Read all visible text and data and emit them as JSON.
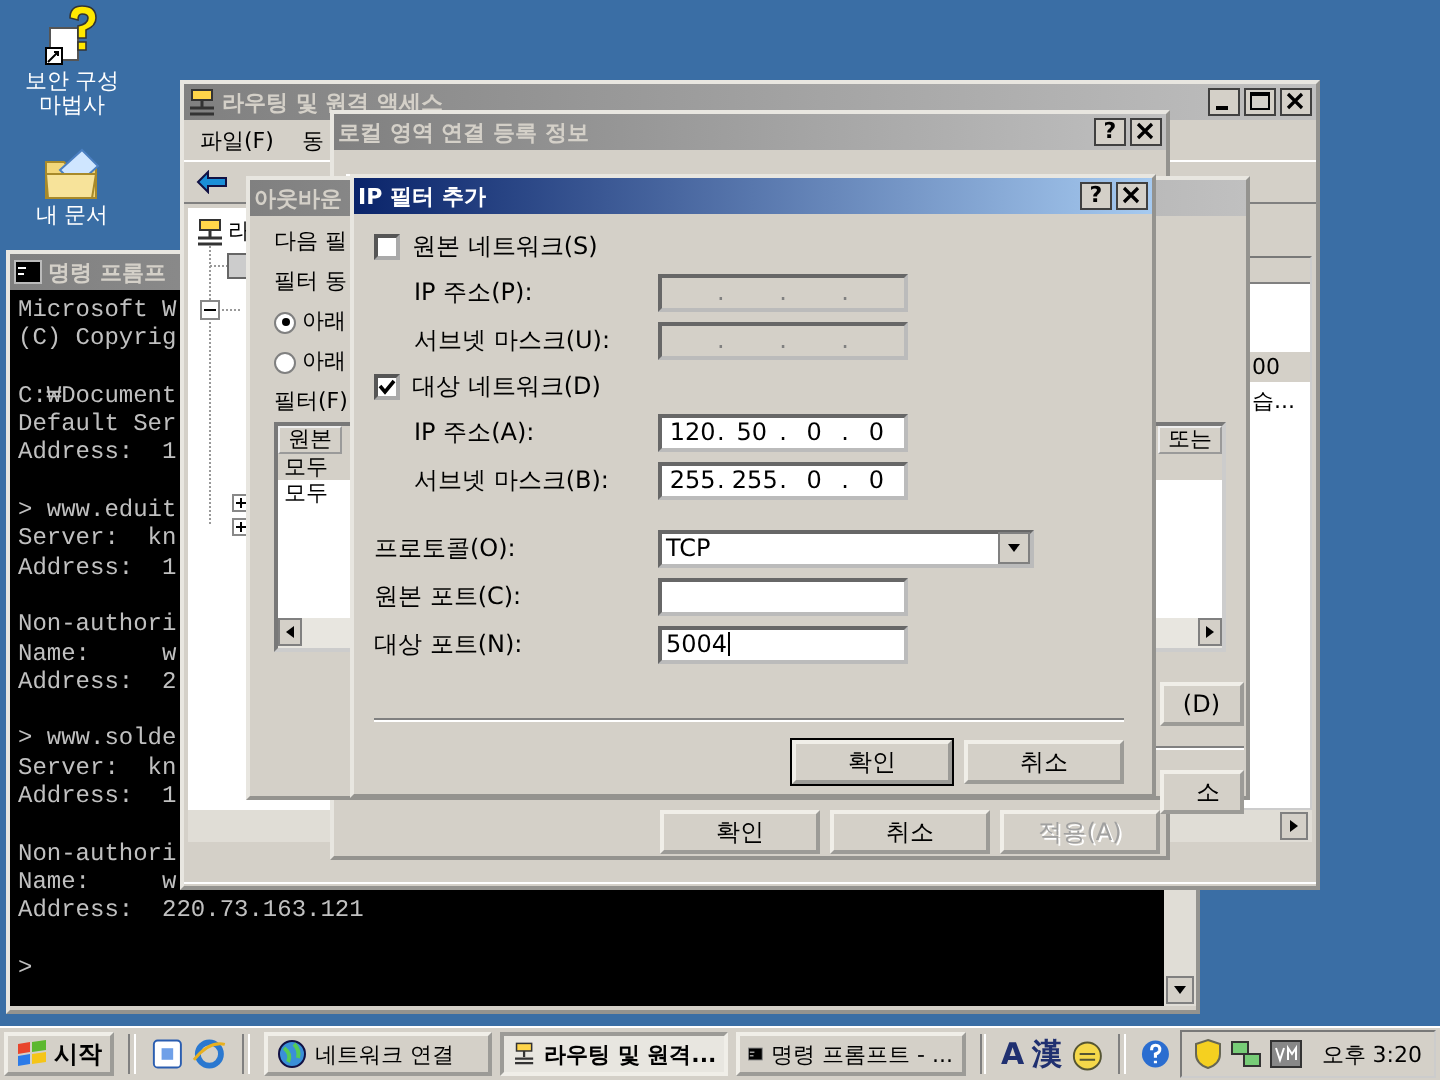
{
  "desktop_icons": [
    {
      "kind": "wizard",
      "label": "보안 구성 마법사"
    },
    {
      "kind": "documents",
      "label": "내 문서"
    }
  ],
  "console": {
    "title": "명령 프롬프",
    "blocks": [
      [
        "Microsoft W",
        "(C) Copyrig"
      ],
      [
        "C:₩Document",
        "Default Ser",
        "Address:  1"
      ],
      [
        "> www.eduit",
        "Server:  kn",
        "Address:  1"
      ],
      [
        "Non-authori",
        "Name:     w",
        "Address:  2"
      ],
      [
        "> www.solde",
        "Server:  kn",
        "Address:  1"
      ],
      [
        "Non-authori",
        "Name:     w",
        "Address:  220.73.163.121"
      ],
      [
        ">"
      ]
    ]
  },
  "routing_window": {
    "title": "라우팅 및 원격 액세스",
    "menu": [
      "파일(F)",
      "동"
    ],
    "tree_root": "라",
    "list_cells": [
      {
        "text": "00",
        "selected": true
      },
      {
        "text": "습...",
        "selected": false
      }
    ]
  },
  "properties_dialog": {
    "title": "로컬 영역 연결 등록 정보",
    "help_button": "?",
    "buttons": [
      {
        "label": "확인",
        "disabled": false
      },
      {
        "label": "취소",
        "disabled": false
      },
      {
        "label": "적용(A)",
        "disabled": true
      }
    ]
  },
  "outbound_dialog": {
    "title": "아웃바운",
    "lines": [
      "다음 필",
      "필터 동"
    ],
    "radios": [
      {
        "label": "아래",
        "selected": true
      },
      {
        "label": "아래",
        "selected": false
      }
    ],
    "filter_label": "필터(F)",
    "list": {
      "columns": [
        "원본",
        "또는"
      ],
      "rows": [
        {
          "text": "모두",
          "selected": true
        },
        {
          "text": "모두",
          "selected": false
        }
      ]
    },
    "buttons": [
      "(D)",
      "소"
    ]
  },
  "ip_filter_dialog": {
    "title": "IP 필터 추가",
    "help_button": "?",
    "separator": ".",
    "source": {
      "label": "원본 네트워크(S)",
      "checked": false,
      "ip_label": "IP 주소(P):",
      "mask_label": "서브넷 마스크(U):"
    },
    "destination": {
      "label": "대상 네트워크(D)",
      "checked": true,
      "ip_label": "IP 주소(A):",
      "ip": [
        "120",
        "50",
        "0",
        "0"
      ],
      "mask_label": "서브넷 마스크(B):",
      "mask": [
        "255",
        "255",
        "0",
        "0"
      ]
    },
    "protocol": {
      "label": "프로토콜(O):",
      "value": "TCP"
    },
    "source_port": {
      "label": "원본 포트(C):"
    },
    "destination_port": {
      "label": "대상 포트(N):",
      "value": "5004"
    },
    "buttons": [
      {
        "label": "확인",
        "default": true
      },
      {
        "label": "취소",
        "default": false
      }
    ]
  },
  "taskbar": {
    "start": "시작",
    "tasks": [
      {
        "kind": "network",
        "label": "네트워크 연결",
        "selected": false
      },
      {
        "kind": "routing",
        "label": "라우팅 및 원격...",
        "selected": true
      },
      {
        "kind": "console",
        "label": "명령 프롬프트 - ...",
        "selected": false
      }
    ],
    "language": [
      "A",
      "漢"
    ],
    "clock": "오후 3:20"
  }
}
